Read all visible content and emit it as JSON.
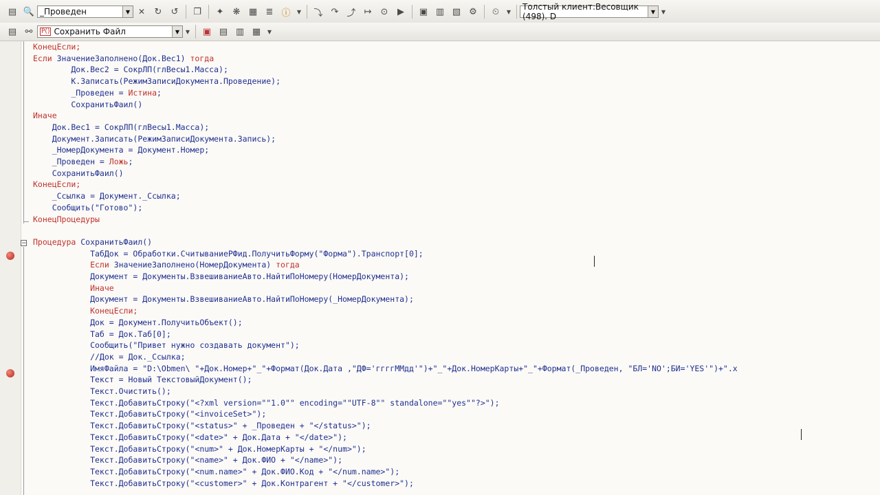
{
  "toolbar1": {
    "search_value": "_Проведен",
    "config_value": "Толстый клиент:Весовщик (498). D",
    "icons": [
      "search-icon",
      "clear-icon",
      "find-next-icon",
      "find-prev-icon",
      "bookmark-icon",
      "wizard-icon",
      "module-icon",
      "template-icon",
      "info-icon",
      "dropdown-arrow-icon",
      "step-into-icon",
      "step-over-icon",
      "step-out-icon",
      "run-to-cursor-icon",
      "breakpoint-icon",
      "go-icon",
      "stop-icon",
      "watch-icon",
      "calc-stack-icon",
      "call-stack-icon",
      "timer-icon"
    ]
  },
  "toolbar2": {
    "proc_value": "Сохранить Файл",
    "proc_badge": "P()"
  },
  "code_lines": [
    [
      "КонецЕсли;"
    ],
    [
      "Если ",
      "ЗначениеЗаполнено(Док.Вес1) ",
      "тогда"
    ],
    [
      "        Док.Вес2 = СокрЛП(глВесы1.Масса);"
    ],
    [
      "        К.Записать(РежимЗаписиДокумента.Проведение);"
    ],
    [
      "        _Проведен = ",
      "Истина",
      ";"
    ],
    [
      "        СохранитьФаил()"
    ],
    [
      "Иначе"
    ],
    [
      "    Док.Вес1 = СокрЛП(глВесы1.Масса);"
    ],
    [
      "    Документ.Записать(РежимЗаписиДокумента.Запись);"
    ],
    [
      "    _НомерДокумента = Документ.Номер;"
    ],
    [
      "    _Проведен = ",
      "Ложь",
      ";"
    ],
    [
      "    СохранитьФаил()"
    ],
    [
      "КонецЕсли;"
    ],
    [
      "    _Ссылка = Документ._Ссылка;"
    ],
    [
      "    Сообщить(\"Готово\");"
    ],
    [
      "КонецПроцедуры"
    ],
    [
      ""
    ],
    [
      "Процедура ",
      "СохранитьФаил()"
    ],
    [
      "            ТабДок = Обработки.СчитываниеРФид.ПолучитьФорму(\"Форма\").Транспорт[0];"
    ],
    [
      "            Если ",
      "ЗначениеЗаполнено(НомерДокумента) ",
      "тогда"
    ],
    [
      "            Документ = Документы.ВзвешиваниеАвто.НайтиПоНомеру(НомерДокумента);"
    ],
    [
      "            Иначе"
    ],
    [
      "            Документ = Документы.ВзвешиваниеАвто.НайтиПоНомеру(_НомерДокумента);"
    ],
    [
      "            КонецЕсли;"
    ],
    [
      "            Док = Документ.ПолучитьОбъект();"
    ],
    [
      "            Таб = Док.Таб[0];"
    ],
    [
      "            Сообщить(\"Привет нужно создавать документ\");"
    ],
    [
      "            //Док = Док._Ссылка;"
    ],
    [
      "            ИмяФайла = \"D:\\Obmen\\ \"+Док.Номер+\"_\"+Формат(Док.Дата ,\"ДФ='ггггММдд'\")+\"_\"+Док.НомерКарты+\"_\"+Формат(_Проведен, \"БЛ='NO';БИ='YES'\")+\".x"
    ],
    [
      "            Текст = Новый ТекстовыйДокумент();"
    ],
    [
      "            Текст.Очистить();"
    ],
    [
      "            Текст.ДобавитьСтроку(\"<?xml version=\"\"1.0\"\" encoding=\"\"UTF-8\"\" standalone=\"\"yes\"\"?>\");"
    ],
    [
      "            Текст.ДобавитьСтроку(\"<invoiceSet>\");"
    ],
    [
      "            Текст.ДобавитьСтроку(\"<status>\" + _Проведен + \"</status>\");"
    ],
    [
      "            Текст.ДобавитьСтроку(\"<date>\" + Док.Дата + \"</date>\");"
    ],
    [
      "            Текст.ДобавитьСтроку(\"<num>\" + Док.НомерКарты + \"</num>\");"
    ],
    [
      "            Текст.ДобавитьСтроку(\"<name>\" + Док.ФИО + \"</name>\");"
    ],
    [
      "            Текст.ДобавитьСтроку(\"<num.name>\" + Док.ФИО.Код + \"</num.name>\");"
    ],
    [
      "            Текст.ДобавитьСтроку(\"<customer>\" + Док.Контрагент + \"</customer>\");"
    ]
  ]
}
